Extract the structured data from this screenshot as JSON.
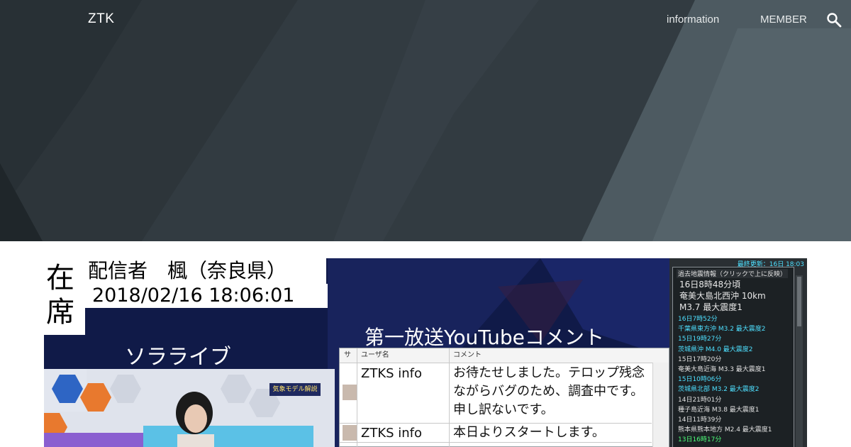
{
  "header": {
    "site_title": "ZTK",
    "nav": [
      {
        "label": "information"
      },
      {
        "label": "MEMBER"
      }
    ],
    "search_icon": "search-icon"
  },
  "broadcast": {
    "seat_status": "在\n席",
    "host": "配信者　楓（奈良県）",
    "timestamp": "2018/02/16 18:06:01",
    "live_title": "ソラライブ",
    "studio_tag": "気象モデル解説",
    "youtube_title": "第一放送YouTubeコメント",
    "comment_columns": [
      "サ",
      "ユーザ名",
      "コメント"
    ],
    "comments": [
      {
        "user": "ZTKS info",
        "message": "お待たせしました。テロップ残念ながらバグのため、調査中です。申し訳ないです。"
      },
      {
        "user": "ZTKS info",
        "message": "本日よりスタートします。"
      }
    ],
    "quake": {
      "updated": "最終更新：16日 18:03",
      "panel_title": "過去地震情報（クリックで上に反映）",
      "latest": [
        "16日8時48分頃",
        "奄美大島北西沖 10km",
        "M3.7 最大震度1"
      ],
      "entries": [
        {
          "text": "16日7時52分",
          "color": "#4ee0ff"
        },
        {
          "text": "千葉県東方沖 M3.2 最大震度2",
          "color": "#4ee0ff"
        },
        {
          "text": "15日19時27分",
          "color": "#4ee0ff"
        },
        {
          "text": "茨城県沖 M4.0 最大震度2",
          "color": "#4ee0ff"
        },
        {
          "text": "15日17時20分",
          "color": "#e0e0e0"
        },
        {
          "text": "奄美大島近海 M3.3 最大震度1",
          "color": "#e0e0e0"
        },
        {
          "text": "15日10時06分",
          "color": "#4ee0ff"
        },
        {
          "text": "茨城県北部 M3.2 最大震度2",
          "color": "#4ee0ff"
        },
        {
          "text": "14日21時01分",
          "color": "#e0e0e0"
        },
        {
          "text": "種子島近海 M3.8 最大震度1",
          "color": "#e0e0e0"
        },
        {
          "text": "14日11時39分",
          "color": "#e0e0e0"
        },
        {
          "text": "熊本県熊本地方 M2.4 最大震度1",
          "color": "#e0e0e0"
        },
        {
          "text": "13日16時17分",
          "color": "#4eff7a"
        }
      ]
    }
  }
}
